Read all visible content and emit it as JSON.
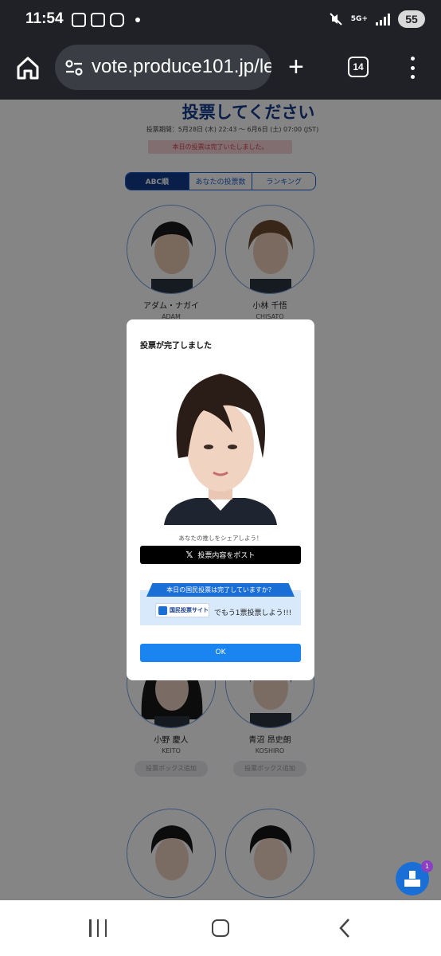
{
  "status_bar": {
    "time": "11:54",
    "network": "5G+",
    "battery": "55"
  },
  "browser": {
    "url": "vote.produce101.jp/le",
    "tab_count": "14"
  },
  "page": {
    "title": "投票してください",
    "vote_period": "投票期間：5月28日 (木) 22:43 ～ 6月6日 (土) 07:00 (JST)",
    "done_notice": "本日の投票は完了いたしました。",
    "tabs": [
      {
        "label": "ABC順"
      },
      {
        "label": "あなたの投票数"
      },
      {
        "label": "ランキング"
      }
    ],
    "trainees": [
      {
        "name": "アダム・ナガイ",
        "roman": "ADAM"
      },
      {
        "name": "小林 千悟",
        "roman": "CHISATO"
      },
      {
        "name": "小野 慶人",
        "roman": "KEITO",
        "add_label": "投票ボックス追加"
      },
      {
        "name": "青沼 昂史朗",
        "roman": "KOSHIRO",
        "add_label": "投票ボックス追加"
      }
    ]
  },
  "modal": {
    "title": "投票が完了しました",
    "share_prompt": "あなたの推しをシェアしよう！",
    "post_label": "投票内容をポスト",
    "x_icon": "𝕏",
    "kokumin_banner": "本日の国民投票は完了していますか？",
    "site_badge": "国民投票サイト",
    "one_more": "でもう1票投票しよう!!!",
    "ok_label": "OK"
  },
  "fab": {
    "badge": "1"
  },
  "colors": {
    "brand_navy": "#123a8c",
    "brand_blue": "#1a85f0",
    "notice_red": "#d23b4d"
  }
}
